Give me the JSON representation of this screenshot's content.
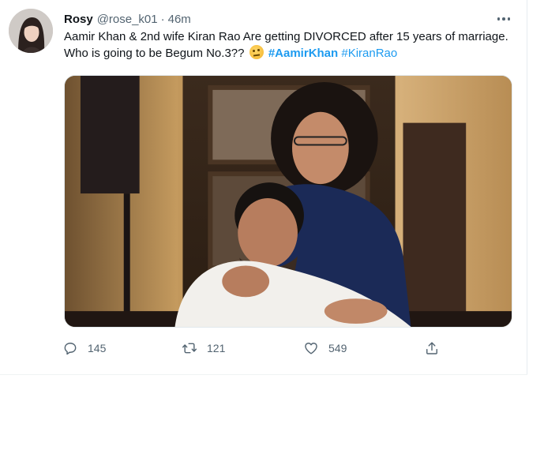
{
  "tweet": {
    "author_name": "Rosy",
    "author_handle": "@rose_k01",
    "separator": "·",
    "time_ago": "46m",
    "text_main": "Aamir Khan & 2nd wife Kiran Rao Are getting DIVORCED after 15 years of marriage. Who is going to be Begum No.3??",
    "emoji": "thinking-face",
    "hashtags": [
      "#AamirKhan",
      "#KiranRao"
    ],
    "reply_count": "145",
    "retweet_count": "121",
    "like_count": "549"
  },
  "icons": {
    "more": "more-icon",
    "reply": "reply-icon",
    "retweet": "retweet-icon",
    "like": "like-icon",
    "share": "share-icon"
  },
  "colors": {
    "text": "#0f1419",
    "secondary": "#536471",
    "link": "#1d9bf0",
    "border": "#e6ecf0"
  }
}
